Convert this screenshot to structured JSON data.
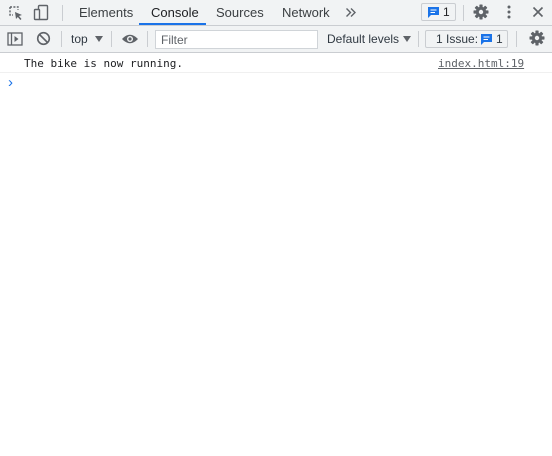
{
  "tabs": {
    "items": [
      {
        "label": "Elements"
      },
      {
        "label": "Console"
      },
      {
        "label": "Sources"
      },
      {
        "label": "Network"
      }
    ],
    "more_icon": "double-chevron-right-icon",
    "messages_badge_count": "1"
  },
  "toolbar": {
    "context": "top",
    "filter_placeholder": "Filter",
    "levels": "Default levels",
    "issues_label": "1 Issue:",
    "issues_count": "1"
  },
  "console": {
    "messages": [
      {
        "text": "The bike is now running.",
        "source": "index.html:19"
      }
    ],
    "prompt": "›"
  },
  "colors": {
    "accent": "#1a73e8",
    "toolbar_bg": "#f1f3f4"
  }
}
